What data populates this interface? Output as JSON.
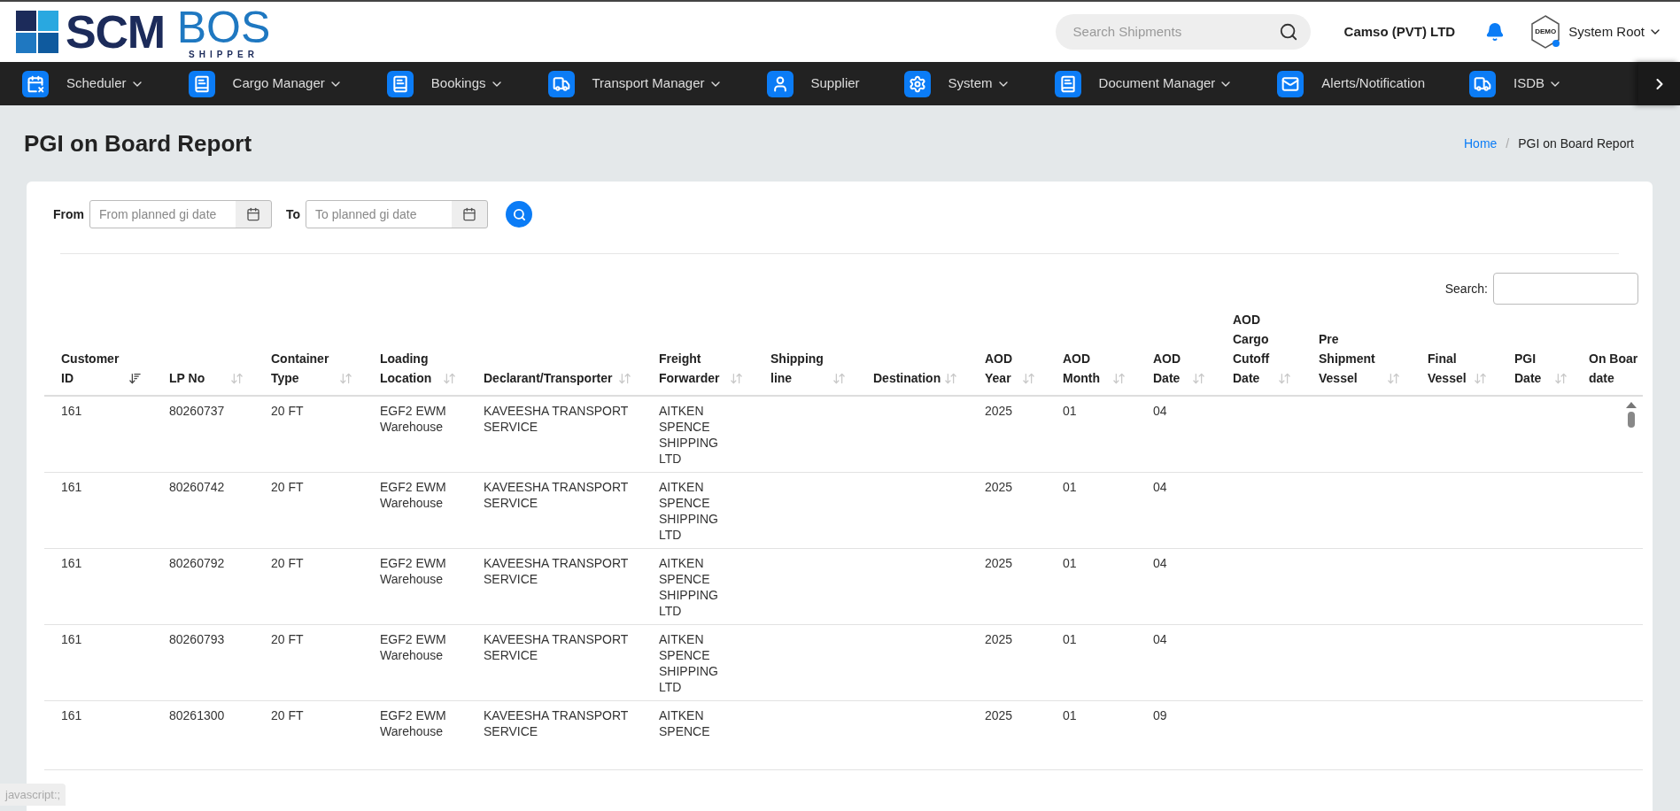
{
  "logo": {
    "main": "SCM",
    "accent": "BOS",
    "tagline": "SHIPPER"
  },
  "header": {
    "search_placeholder": "Search Shipments",
    "company": "Camso (PVT) LTD",
    "avatar_badge": "DEMO",
    "user": "System Root"
  },
  "nav": {
    "items": [
      {
        "label": "Scheduler",
        "kind": "calendar",
        "dropdown": true
      },
      {
        "label": "Cargo Manager",
        "kind": "book",
        "dropdown": true
      },
      {
        "label": "Bookings",
        "kind": "book",
        "dropdown": true
      },
      {
        "label": "Transport Manager",
        "kind": "truck",
        "dropdown": true
      },
      {
        "label": "Supplier",
        "kind": "user",
        "dropdown": false
      },
      {
        "label": "System",
        "kind": "gears",
        "dropdown": true
      },
      {
        "label": "Document Manager",
        "kind": "book",
        "dropdown": true
      },
      {
        "label": "Alerts/Notification",
        "kind": "mail",
        "dropdown": false
      },
      {
        "label": "ISDB",
        "kind": "truck",
        "dropdown": true
      }
    ]
  },
  "page": {
    "title": "PGI on Board Report",
    "breadcrumb_separator": "/",
    "breadcrumb": [
      {
        "label": "Home",
        "link": true
      },
      {
        "label": "PGI on Board Report",
        "link": false
      }
    ]
  },
  "filters": {
    "from_label": "From",
    "from_placeholder": "From planned gi date",
    "to_label": "To",
    "to_placeholder": "To planned gi date"
  },
  "table": {
    "search_label": "Search:",
    "columns": [
      {
        "label": "Customer ID",
        "sorted": true
      },
      {
        "label": "LP No",
        "sorted": false
      },
      {
        "label": "Container Type",
        "sorted": false
      },
      {
        "label": "Loading Location",
        "sorted": false
      },
      {
        "label": "Declarant/Transporter",
        "sorted": false
      },
      {
        "label": "Freight Forwarder",
        "sorted": false
      },
      {
        "label": "Shipping line",
        "sorted": false
      },
      {
        "label": "Destination",
        "sorted": false
      },
      {
        "label": "AOD Year",
        "sorted": false
      },
      {
        "label": "AOD Month",
        "sorted": false
      },
      {
        "label": "AOD Date",
        "sorted": false
      },
      {
        "label": "AOD Cargo Cutoff Date",
        "sorted": false
      },
      {
        "label": "Pre Shipment Vessel",
        "sorted": false
      },
      {
        "label": "Final Vessel",
        "sorted": false
      },
      {
        "label": "PGI Date",
        "sorted": false
      },
      {
        "label": "On Boar date"
      }
    ],
    "rows": [
      {
        "customer_id": "161",
        "lp_no": "80260737",
        "container_type": "20 FT",
        "loading_location": "EGF2 EWM Warehouse",
        "declarant": "KAVEESHA TRANSPORT SERVICE",
        "freight_forwarder": "AITKEN SPENCE SHIPPING LTD",
        "aod_year": "2025",
        "aod_month": "01",
        "aod_date": "04"
      },
      {
        "customer_id": "161",
        "lp_no": "80260742",
        "container_type": "20 FT",
        "loading_location": "EGF2 EWM Warehouse",
        "declarant": "KAVEESHA TRANSPORT SERVICE",
        "freight_forwarder": "AITKEN SPENCE SHIPPING LTD",
        "aod_year": "2025",
        "aod_month": "01",
        "aod_date": "04"
      },
      {
        "customer_id": "161",
        "lp_no": "80260792",
        "container_type": "20 FT",
        "loading_location": "EGF2 EWM Warehouse",
        "declarant": "KAVEESHA TRANSPORT SERVICE",
        "freight_forwarder": "AITKEN SPENCE SHIPPING LTD",
        "aod_year": "2025",
        "aod_month": "01",
        "aod_date": "04"
      },
      {
        "customer_id": "161",
        "lp_no": "80260793",
        "container_type": "20 FT",
        "loading_location": "EGF2 EWM Warehouse",
        "declarant": "KAVEESHA TRANSPORT SERVICE",
        "freight_forwarder": "AITKEN SPENCE SHIPPING LTD",
        "aod_year": "2025",
        "aod_month": "01",
        "aod_date": "04"
      },
      {
        "customer_id": "161",
        "lp_no": "80261300",
        "container_type": "20 FT",
        "loading_location": "EGF2 EWM Warehouse",
        "declarant": "KAVEESHA TRANSPORT SERVICE",
        "freight_forwarder": "AITKEN SPENCE",
        "aod_year": "2025",
        "aod_month": "01",
        "aod_date": "09"
      }
    ]
  },
  "status_text": "javascript:;"
}
